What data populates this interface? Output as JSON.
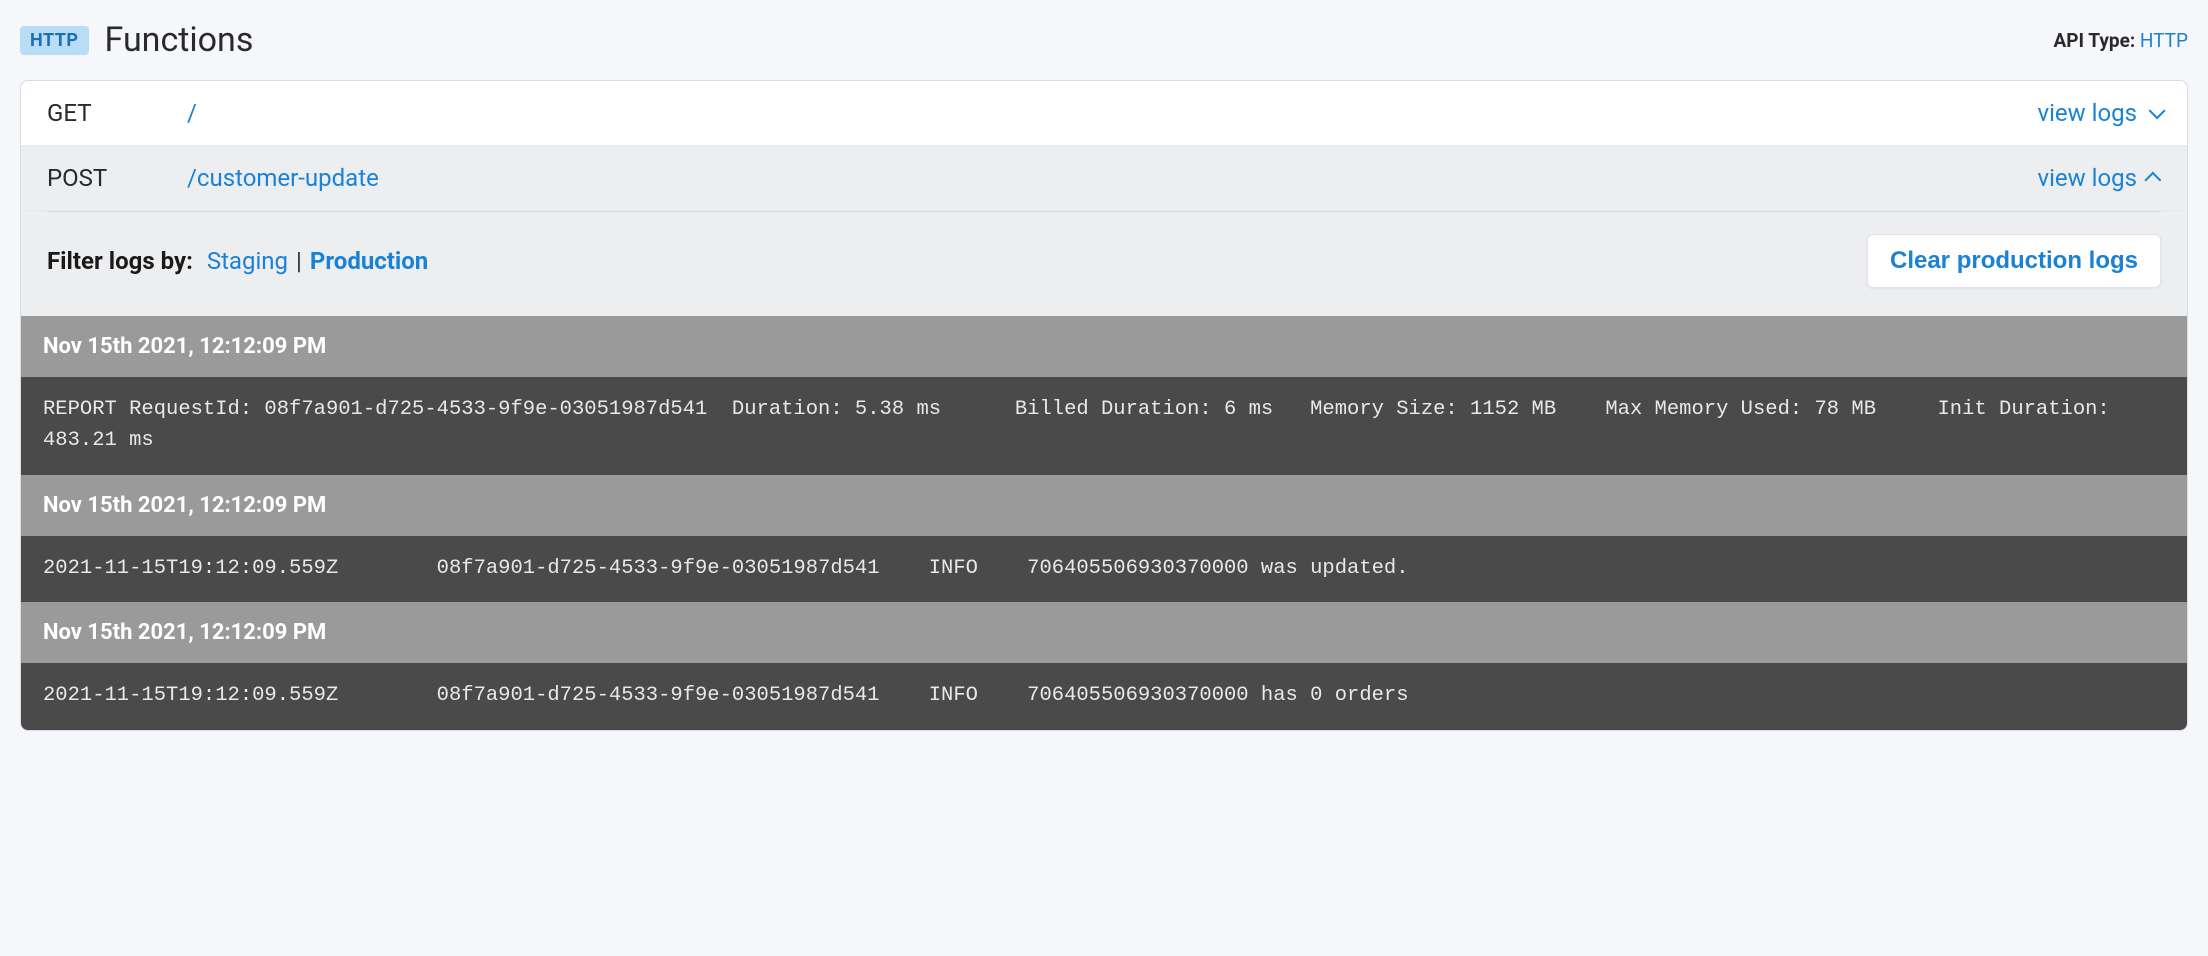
{
  "header": {
    "badge": "HTTP",
    "title": "Functions",
    "apiTypeLabel": "API Type:",
    "apiTypeValue": "HTTP"
  },
  "functions": [
    {
      "method": "GET",
      "path": "/",
      "viewLogsLabel": "view logs",
      "expanded": false
    },
    {
      "method": "POST",
      "path": "/customer-update",
      "viewLogsLabel": "view logs",
      "expanded": true
    }
  ],
  "filter": {
    "label": "Filter logs by:",
    "staging": "Staging",
    "separator": "|",
    "production": "Production",
    "clearButton": "Clear production logs"
  },
  "logs": [
    {
      "timestamp": "Nov 15th 2021, 12:12:09 PM",
      "body": "REPORT RequestId: 08f7a901-d725-4533-9f9e-03051987d541  Duration: 5.38 ms      Billed Duration: 6 ms   Memory Size: 1152 MB    Max Memory Used: 78 MB     Init Duration: 483.21 ms"
    },
    {
      "timestamp": "Nov 15th 2021, 12:12:09 PM",
      "body": "2021-11-15T19:12:09.559Z        08f7a901-d725-4533-9f9e-03051987d541    INFO    706405506930370000 was updated."
    },
    {
      "timestamp": "Nov 15th 2021, 12:12:09 PM",
      "body": "2021-11-15T19:12:09.559Z        08f7a901-d725-4533-9f9e-03051987d541    INFO    706405506930370000 has 0 orders"
    }
  ]
}
